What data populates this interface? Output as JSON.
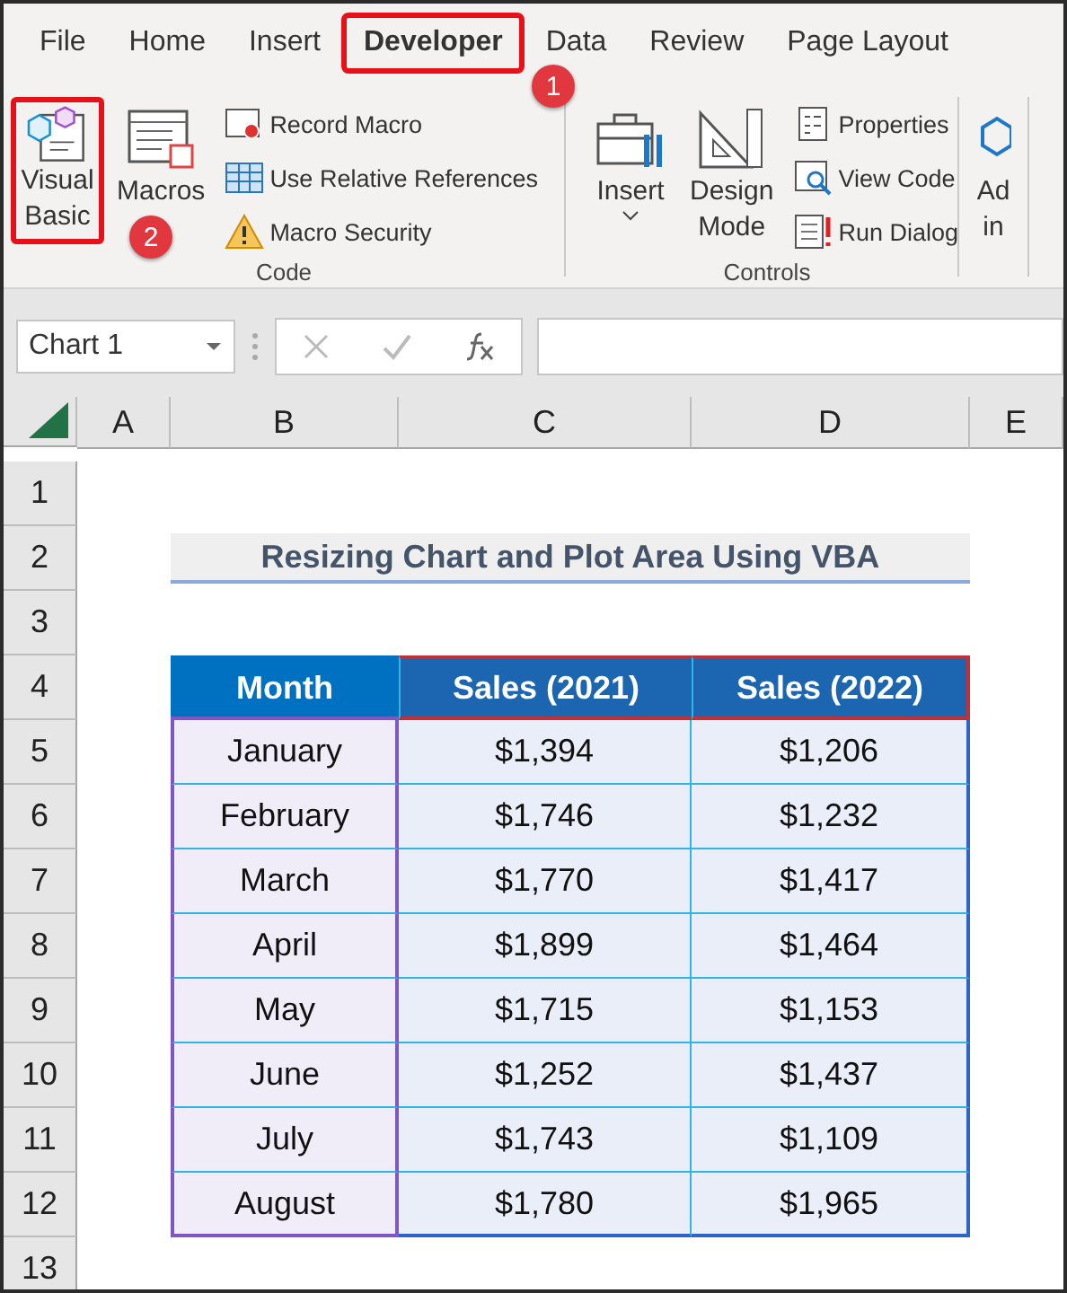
{
  "ribbon_tabs": [
    {
      "label": "File",
      "selected": false
    },
    {
      "label": "Home",
      "selected": false
    },
    {
      "label": "Insert",
      "selected": false
    },
    {
      "label": "Developer",
      "selected": true,
      "callout": "1"
    },
    {
      "label": "Data",
      "selected": false
    },
    {
      "label": "Review",
      "selected": false
    },
    {
      "label": "Page Layout",
      "selected": false
    }
  ],
  "groups": [
    {
      "name": "Code",
      "large": [
        {
          "kind": "vb",
          "lines": [
            "Visual",
            "Basic"
          ],
          "callout": "2"
        },
        {
          "kind": "macros",
          "lines": [
            "Macros"
          ]
        }
      ],
      "small": [
        {
          "kind": "record",
          "label": "Record Macro"
        },
        {
          "kind": "relative",
          "label": "Use Relative References"
        },
        {
          "kind": "security",
          "label": "Macro Security"
        }
      ]
    },
    {
      "name": "Controls",
      "large": [
        {
          "kind": "insert",
          "lines": [
            "Insert"
          ],
          "dropdown": true
        },
        {
          "kind": "design",
          "lines": [
            "Design",
            "Mode"
          ]
        }
      ],
      "small": [
        {
          "kind": "properties",
          "label": "Properties"
        },
        {
          "kind": "viewcode",
          "label": "View Code"
        },
        {
          "kind": "rundialog",
          "label": "Run Dialog"
        }
      ]
    },
    {
      "large": [
        {
          "kind": "addins",
          "lines": [
            "Ad",
            "in"
          ]
        }
      ]
    }
  ],
  "name_box": "Chart 1",
  "columns": [
    "A",
    "B",
    "C",
    "D",
    "E"
  ],
  "row_numbers": [
    "1",
    "2",
    "3",
    "4",
    "5",
    "6",
    "7",
    "8",
    "9",
    "10",
    "11",
    "12",
    "13"
  ],
  "title": "Resizing Chart and Plot Area Using VBA",
  "table": {
    "headers": [
      "Month",
      "Sales (2021)",
      "Sales (2022)"
    ],
    "rows": [
      [
        "January",
        "$1,394",
        "$1,206"
      ],
      [
        "February",
        "$1,746",
        "$1,232"
      ],
      [
        "March",
        "$1,770",
        "$1,417"
      ],
      [
        "April",
        "$1,899",
        "$1,464"
      ],
      [
        "May",
        "$1,715",
        "$1,153"
      ],
      [
        "June",
        "$1,252",
        "$1,437"
      ],
      [
        "July",
        "$1,743",
        "$1,109"
      ],
      [
        "August",
        "$1,780",
        "$1,965"
      ]
    ]
  }
}
